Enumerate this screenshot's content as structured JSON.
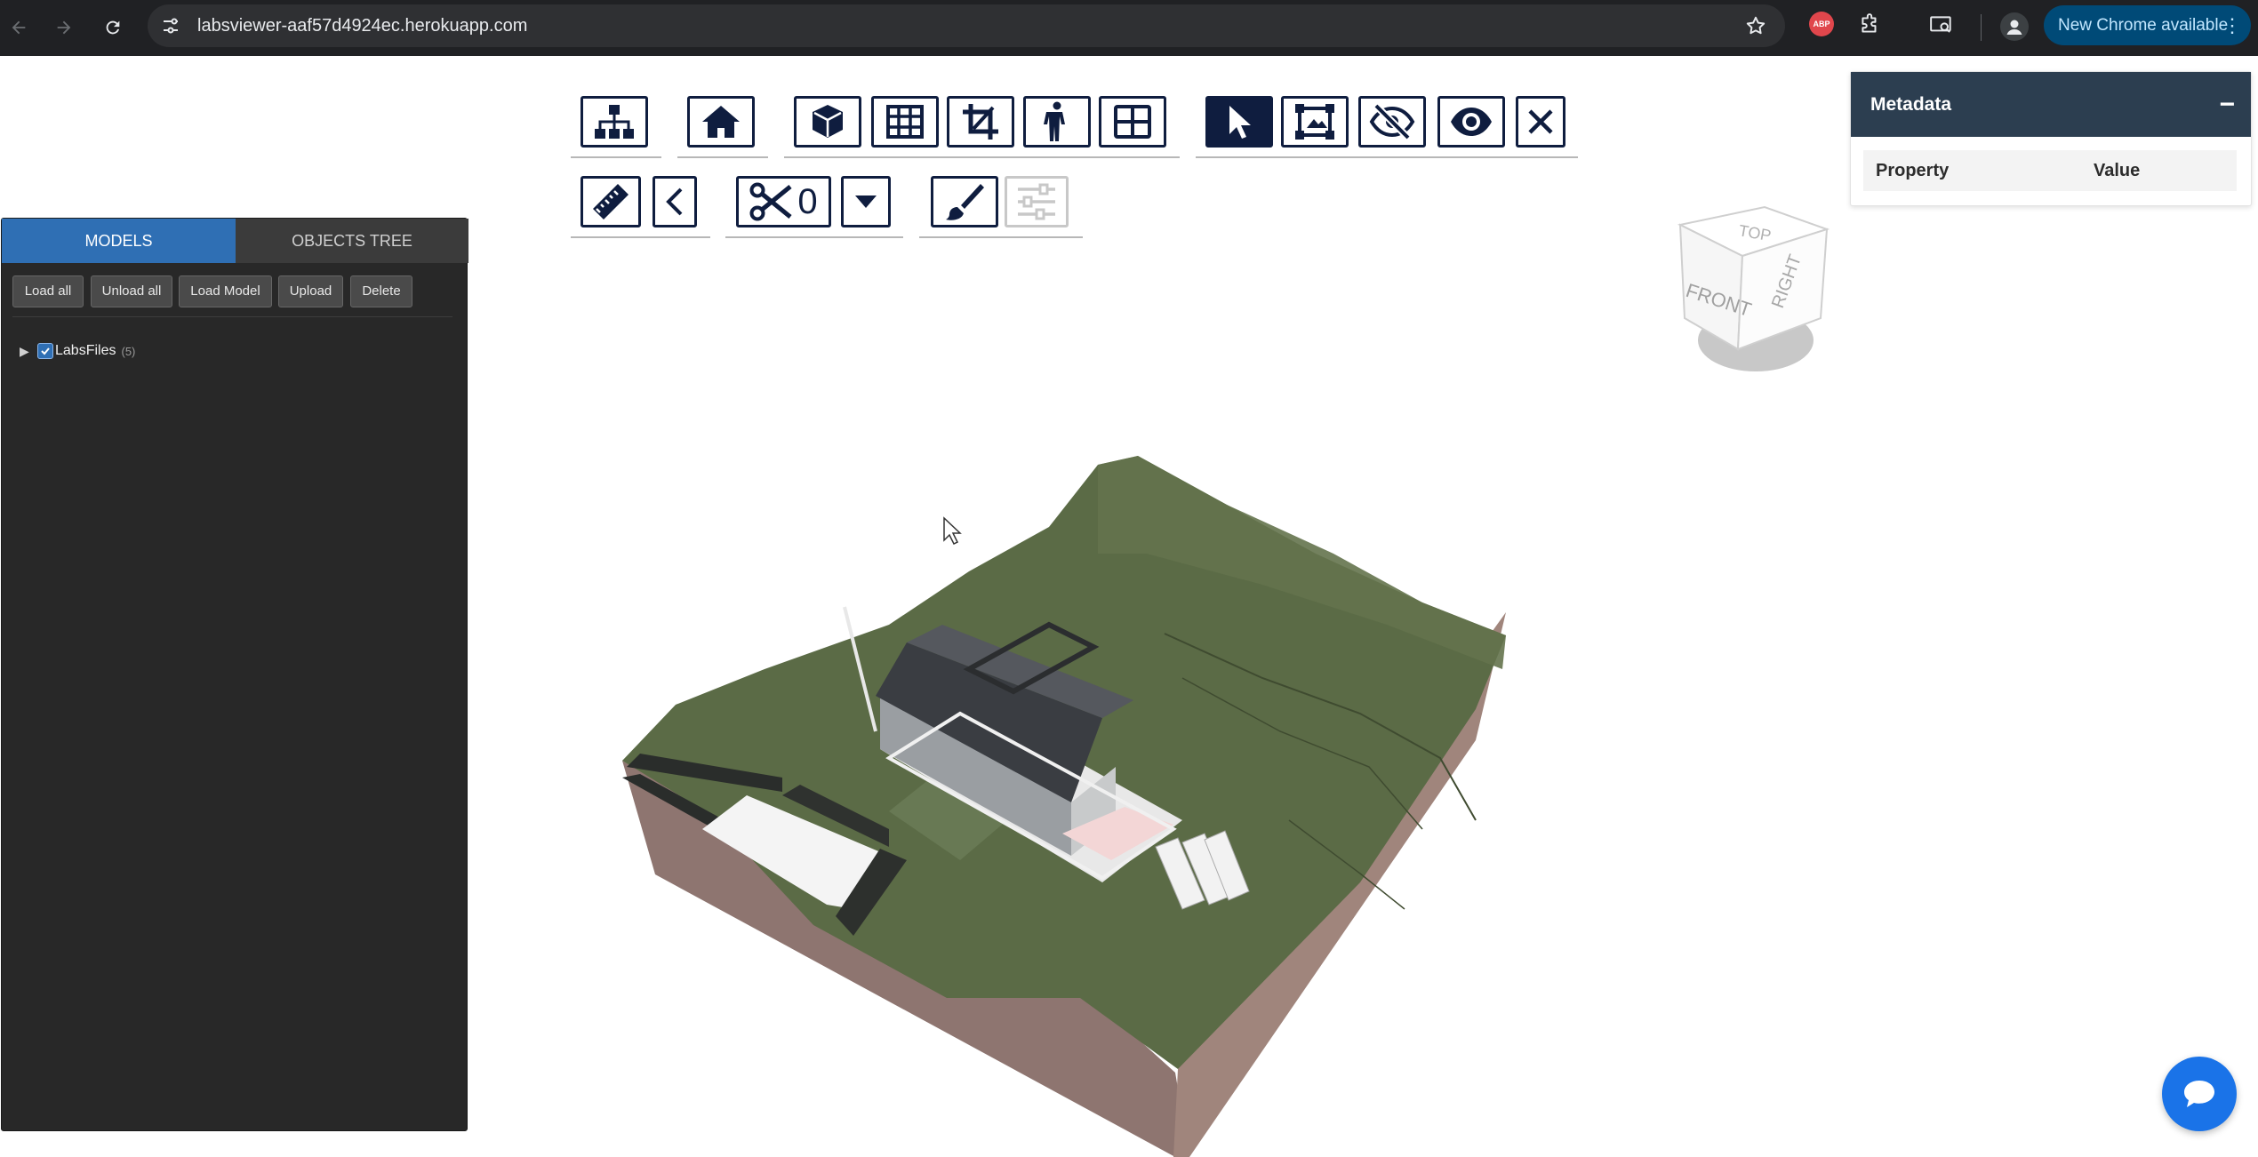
{
  "browser": {
    "url": "labsviewer-aaf57d4924ec.herokuapp.com",
    "update_label": "New Chrome available",
    "abp_label": "ABP"
  },
  "toolbar": {
    "row1": [
      "hierarchy-icon",
      "home-icon",
      "cube-icon",
      "grid-icon",
      "crop-icon",
      "person-icon",
      "window-icon",
      "pointer-icon",
      "select-box-icon",
      "eye-slash-icon",
      "eye-icon",
      "close-icon"
    ],
    "row2": [
      "ruler-icon",
      "chevron-left-icon",
      "scissors-icon",
      "caret-down-icon",
      "paintbrush-icon",
      "sliders-icon"
    ],
    "section_count": "0"
  },
  "panel": {
    "tabs": [
      "MODELS",
      "OBJECTS TREE"
    ],
    "buttons": [
      "Load all",
      "Unload all",
      "Load Model",
      "Upload",
      "Delete"
    ],
    "tree": {
      "label": "LabsFiles",
      "count": "(5)",
      "checked": true
    }
  },
  "metadata": {
    "title": "Metadata",
    "minimize": "−",
    "col_property": "Property",
    "col_value": "Value"
  },
  "navcube": {
    "top": "TOP",
    "front": "FRONT",
    "right": "RIGHT"
  },
  "colors": {
    "panel_bg": "#282828",
    "tab_active": "#2f6fb4",
    "toolbar_navy": "#0f1d3f",
    "meta_head": "#2c3e50",
    "chat": "#1a73e8"
  }
}
